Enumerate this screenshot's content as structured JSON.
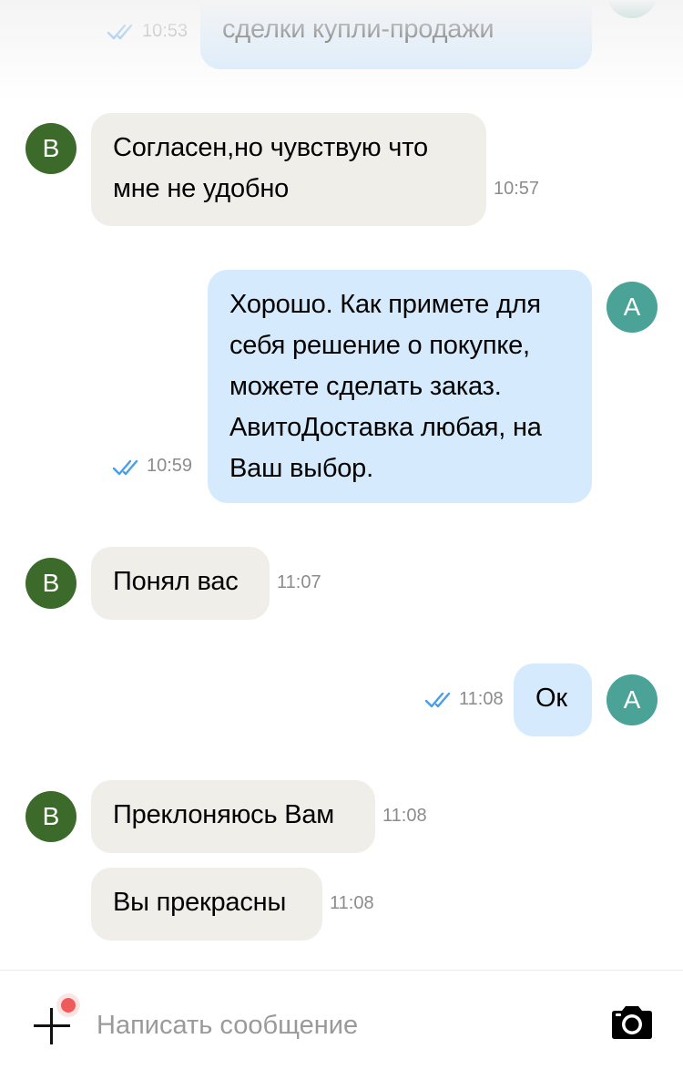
{
  "messages": [
    {
      "side": "out",
      "text": "сделки купли-продажи",
      "time": "10:53",
      "read": true
    },
    {
      "side": "in",
      "avatar": "В",
      "text": "Согласен,но чувствую что мне не удобно",
      "time": "10:57"
    },
    {
      "side": "out",
      "avatar": "А",
      "text": "Хорошо. Как примете для себя решение о покупке, можете сделать заказ. АвитоДоставка любая, на Ваш выбор.",
      "time": "10:59",
      "read": true
    },
    {
      "side": "in",
      "avatar": "В",
      "text": "Понял вас",
      "time": "11:07"
    },
    {
      "side": "out",
      "avatar": "А",
      "text": "Ок",
      "time": "11:08",
      "read": true
    },
    {
      "side": "in",
      "avatar": "В",
      "text": "Преклоняюсь Вам",
      "time": "11:08"
    },
    {
      "side": "in",
      "text": "Вы прекрасны",
      "time": "11:08"
    }
  ],
  "composer": {
    "placeholder": "Написать сообщение",
    "attach_icon": "plus-icon",
    "camera_icon": "camera-icon",
    "has_notification_dot": true
  },
  "colors": {
    "incoming_bubble": "#efeee9",
    "outgoing_bubble": "#d5eafd",
    "avatar_b": "#3c6a2a",
    "avatar_a": "#4aa396",
    "read_tick": "#4a9ee8",
    "notification_dot": "#f15a5a"
  }
}
